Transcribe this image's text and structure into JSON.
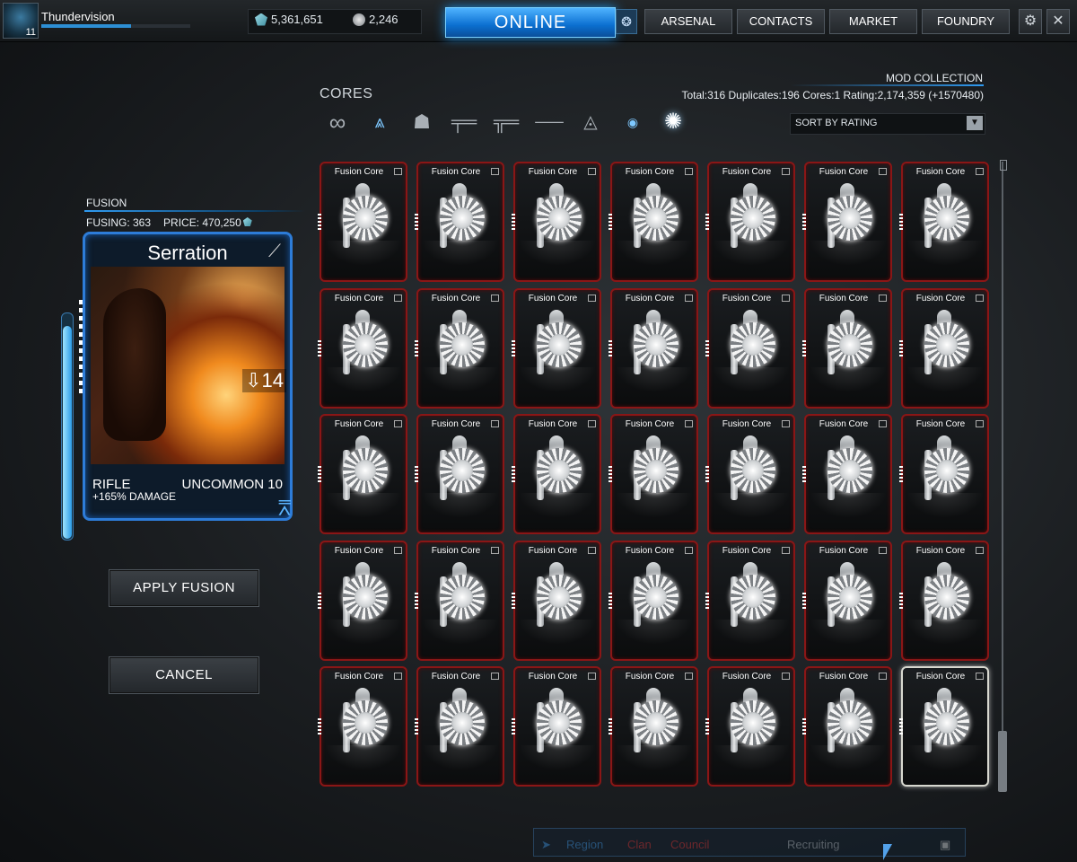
{
  "topbar": {
    "username": "Thundervision",
    "level": "11",
    "credits": "5,361,651",
    "platinum": "2,246",
    "status": "ONLINE",
    "xp_progress": 0.6,
    "nav": [
      "ARSENAL",
      "CONTACTS",
      "MARKET",
      "FOUNDRY"
    ],
    "settings_icon": "gear-icon",
    "close_icon": "close-icon"
  },
  "fusion": {
    "heading": "FUSION",
    "fusing_label": "FUSING: 363",
    "price_label": "PRICE: 470,250",
    "rank_progress": 0.95,
    "mod": {
      "name": "Serration",
      "polarity": "madurai-polarity-icon",
      "drain": "14",
      "type": "RIFLE",
      "rarity": "UNCOMMON 10",
      "effect": "+165% DAMAGE"
    },
    "apply_label": "APPLY FUSION",
    "cancel_label": "CANCEL"
  },
  "cores": {
    "label": "CORES",
    "filters": [
      "all-icon",
      "warframe-icon",
      "aura-icon",
      "rifle-icon",
      "pistol-icon",
      "melee-icon",
      "sentinel-icon",
      "companion-icon",
      "core-icon"
    ],
    "active_filter": "core-icon"
  },
  "collection": {
    "title": "MOD COLLECTION",
    "stats": "Total:316  Duplicates:196  Cores:1  Rating:2,174,359 (+1570480)",
    "sort_label": "SORT BY RATING"
  },
  "grid": {
    "card_name": "Fusion Core",
    "rows": 5,
    "cols": 7,
    "selected_index": 34
  },
  "chat": {
    "items": [
      "Region",
      "Clan",
      "Council",
      "Recruiting"
    ],
    "colors": [
      "#3d8fd8",
      "#d83232",
      "#d83232",
      "#aab0b6"
    ]
  }
}
